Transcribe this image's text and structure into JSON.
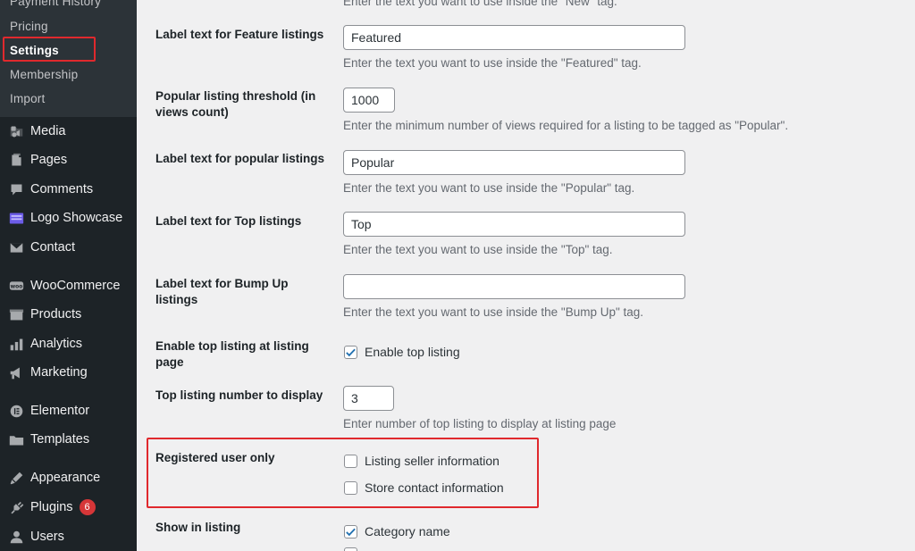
{
  "sidebar": {
    "submenu": [
      {
        "label": "Payment History",
        "current": false
      },
      {
        "label": "Pricing",
        "current": false
      },
      {
        "label": "Settings",
        "current": true
      },
      {
        "label": "Membership",
        "current": false
      },
      {
        "label": "Import",
        "current": false
      }
    ],
    "menu": [
      {
        "label": "Media",
        "icon": "media-icon"
      },
      {
        "label": "Pages",
        "icon": "pages-icon"
      },
      {
        "label": "Comments",
        "icon": "comments-icon"
      },
      {
        "label": "Logo Showcase",
        "icon": "logo-showcase-icon"
      },
      {
        "label": "Contact",
        "icon": "contact-icon"
      },
      {
        "label": "WooCommerce",
        "icon": "woocommerce-icon"
      },
      {
        "label": "Products",
        "icon": "products-icon"
      },
      {
        "label": "Analytics",
        "icon": "analytics-icon"
      },
      {
        "label": "Marketing",
        "icon": "marketing-icon"
      },
      {
        "label": "Elementor",
        "icon": "elementor-icon"
      },
      {
        "label": "Templates",
        "icon": "templates-icon"
      },
      {
        "label": "Appearance",
        "icon": "appearance-icon"
      },
      {
        "label": "Plugins",
        "icon": "plugins-icon",
        "badge": "6"
      },
      {
        "label": "Users",
        "icon": "users-icon"
      }
    ]
  },
  "settings": {
    "top_desc": "Enter the text you want to use inside the \"New\" tag.",
    "feature": {
      "label": "Label text for Feature listings",
      "value": "Featured",
      "desc": "Enter the text you want to use inside the \"Featured\" tag."
    },
    "popular_threshold": {
      "label": "Popular listing threshold (in views count)",
      "value": "1000",
      "desc": "Enter the minimum number of views required for a listing to be tagged as \"Popular\"."
    },
    "popular": {
      "label": "Label text for popular listings",
      "value": "Popular",
      "desc": "Enter the text you want to use inside the \"Popular\" tag."
    },
    "top": {
      "label": "Label text for Top listings",
      "value": "Top",
      "desc": "Enter the text you want to use inside the \"Top\" tag."
    },
    "bump_up": {
      "label": "Label text for Bump Up listings",
      "value": "",
      "desc": "Enter the text you want to use inside the \"Bump Up\" tag."
    },
    "enable_top": {
      "label": "Enable top listing at listing page",
      "checkbox_label": "Enable top listing",
      "checked": true
    },
    "top_number": {
      "label": "Top listing number to display",
      "value": "3",
      "desc": "Enter number of top listing to display at listing page"
    },
    "registered_only": {
      "label": "Registered user only",
      "options": [
        {
          "label": "Listing seller information",
          "checked": false
        },
        {
          "label": "Store contact information",
          "checked": false
        }
      ]
    },
    "show_in_listing": {
      "label": "Show in listing",
      "options": [
        {
          "label": "Category name",
          "checked": true
        }
      ]
    }
  },
  "colors": {
    "sidebar_bg": "#1d2327",
    "submenu_bg": "#2c3338",
    "highlight": "#e0292d",
    "checkbox_check": "#2271b1",
    "badge": "#d63638"
  }
}
